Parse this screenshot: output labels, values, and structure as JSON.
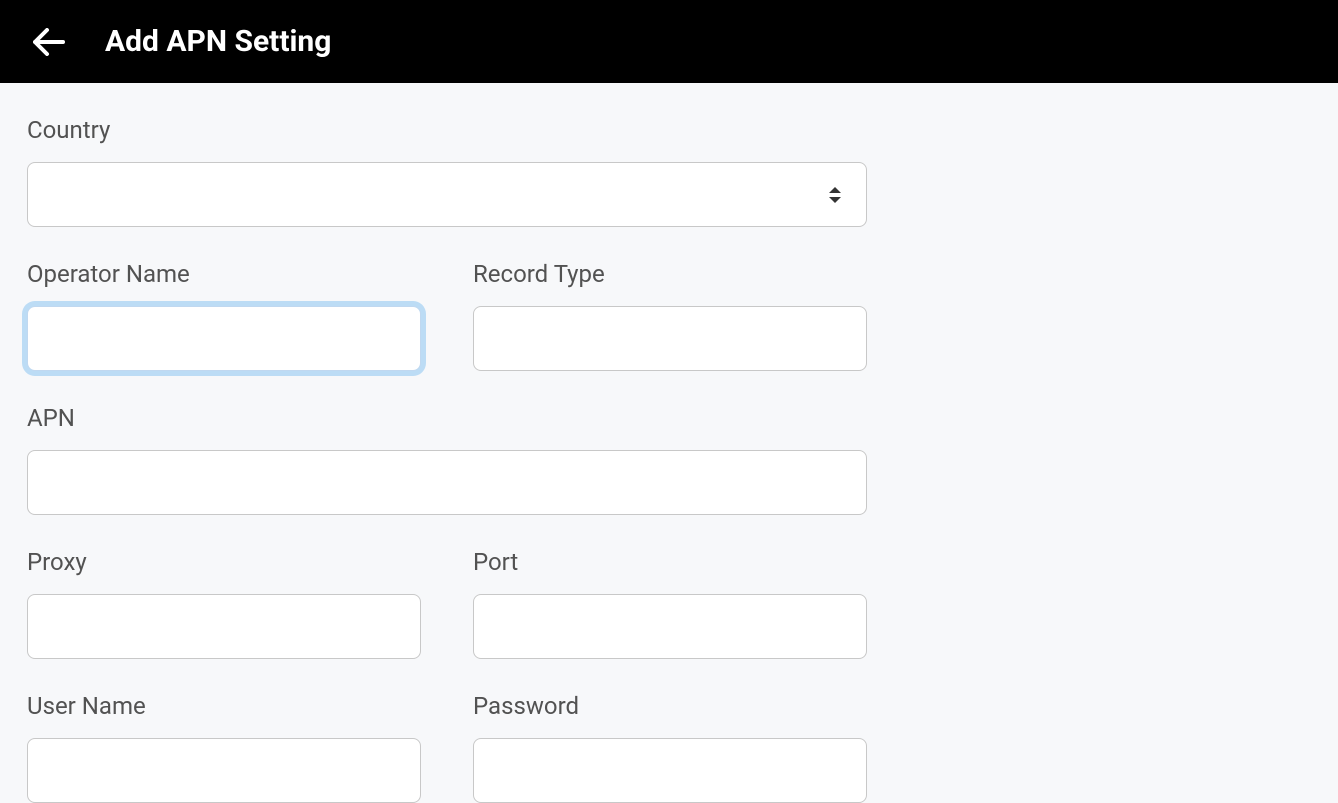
{
  "header": {
    "title": "Add APN Setting"
  },
  "form": {
    "country": {
      "label": "Country",
      "value": ""
    },
    "operator_name": {
      "label": "Operator Name",
      "value": ""
    },
    "record_type": {
      "label": "Record Type",
      "value": ""
    },
    "apn": {
      "label": "APN",
      "value": ""
    },
    "proxy": {
      "label": "Proxy",
      "value": ""
    },
    "port": {
      "label": "Port",
      "value": ""
    },
    "user_name": {
      "label": "User Name",
      "value": ""
    },
    "password": {
      "label": "Password",
      "value": ""
    }
  }
}
